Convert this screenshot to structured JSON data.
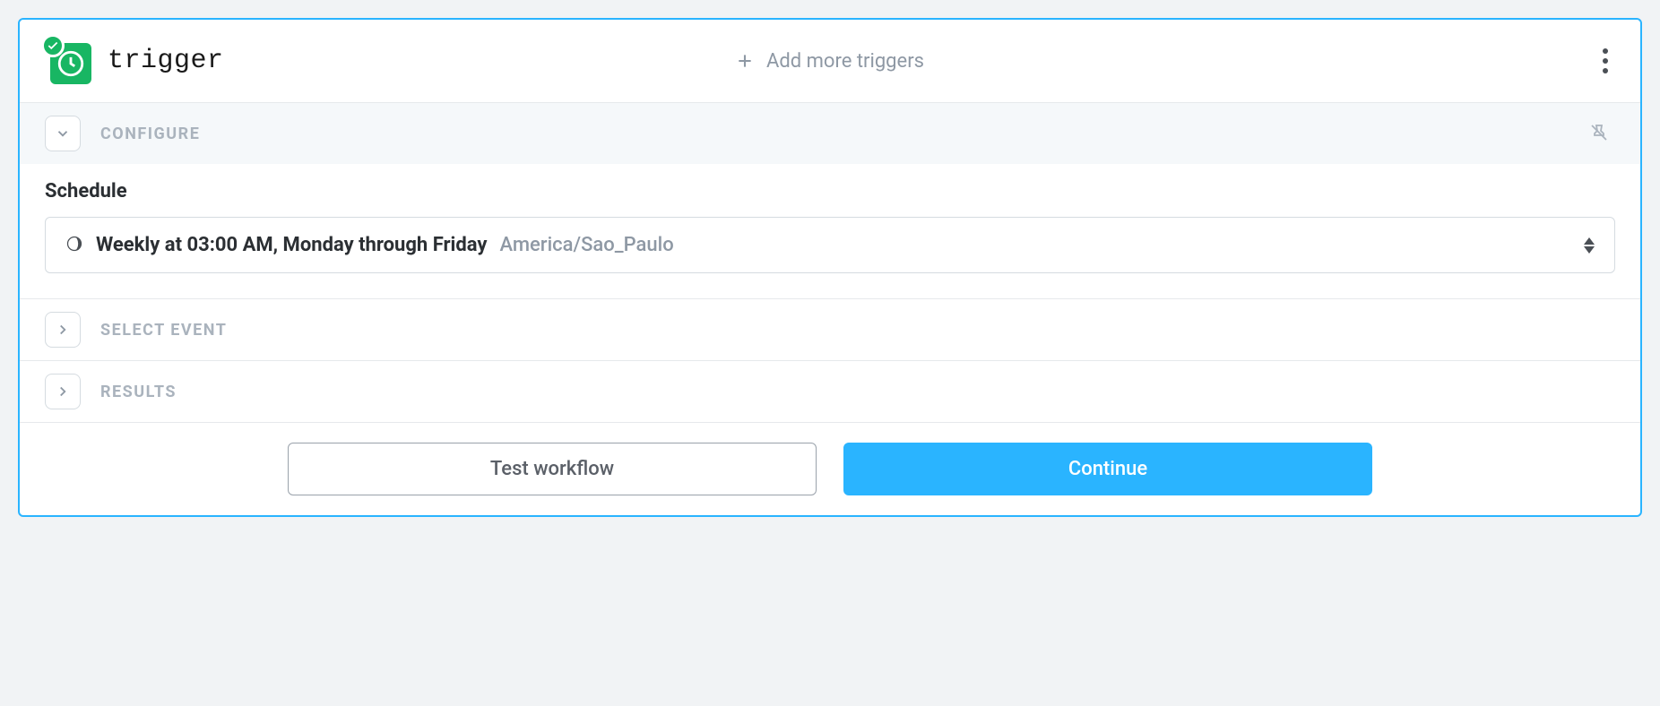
{
  "header": {
    "title": "trigger",
    "add_more_label": "Add more triggers"
  },
  "sections": {
    "configure": {
      "label": "Configure",
      "field_label": "Schedule",
      "schedule_text": "Weekly at 03:00 AM, Monday through Friday",
      "schedule_timezone": "America/Sao_Paulo"
    },
    "select_event": {
      "label": "Select Event"
    },
    "results": {
      "label": "Results"
    }
  },
  "footer": {
    "test_label": "Test workflow",
    "continue_label": "Continue"
  }
}
